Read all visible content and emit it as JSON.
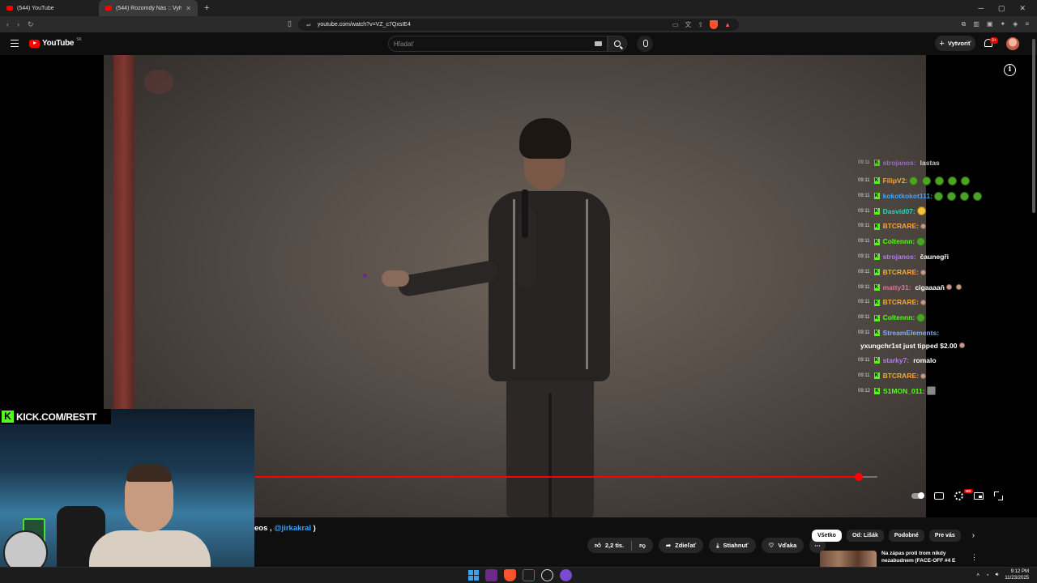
{
  "browser": {
    "tabs": [
      {
        "title": "(544) YouTube",
        "active": false
      },
      {
        "title": "(544) Rozomdý Nás :: Vyhraj",
        "active": true
      }
    ],
    "url": "youtube.com/watch?v=VZ_c7QxsIE4",
    "shield_badge": "1"
  },
  "youtube": {
    "logo": "YouTube",
    "region": "SK",
    "search_placeholder": "Hľadať",
    "create_label": "Vytvoriť",
    "notification_count": "9+"
  },
  "chat": {
    "cropped_top": {
      "time": "09:11",
      "user": "strojanos",
      "message": "lastas"
    },
    "messages": [
      {
        "time": "09:11",
        "user": "FilipV2",
        "color": "#f1a640",
        "message": "",
        "emotes": 5
      },
      {
        "time": "09:11",
        "user": "kokotkokot111",
        "color": "#3ea6ff",
        "message": "",
        "emotes": 4
      },
      {
        "time": "09:11",
        "user": "Dasvid07",
        "color": "#2fd3c1",
        "message": "",
        "emotes": 1
      },
      {
        "time": "09:11",
        "user": "BTCRARE",
        "color": "#f1a640",
        "message": "",
        "emotes": 1
      },
      {
        "time": "09:11",
        "user": "Coltennn",
        "color": "#53fc18",
        "message": "",
        "emotes": 1
      },
      {
        "time": "09:11",
        "user": "strojanos",
        "color": "#b57cf5",
        "message": "čaunegři",
        "emotes": 0
      },
      {
        "time": "09:11",
        "user": "BTCRARE",
        "color": "#f1a640",
        "message": "",
        "emotes": 1
      },
      {
        "time": "09:11",
        "user": "matty31",
        "color": "#e0709a",
        "message": "cigaaaaň",
        "emotes": 2
      },
      {
        "time": "09:11",
        "user": "BTCRARE",
        "color": "#f1a640",
        "message": "",
        "emotes": 1
      },
      {
        "time": "09:11",
        "user": "Coltennn",
        "color": "#53fc18",
        "message": "",
        "emotes": 1
      },
      {
        "time": "09:11",
        "user": "StreamElements",
        "color": "#8aa6ff",
        "message": "yxungchr1st just tipped $2.00",
        "emotes": 1
      },
      {
        "time": "09:11",
        "user": "starky7",
        "color": "#b57cf5",
        "message": "romalo",
        "emotes": 0
      },
      {
        "time": "09:11",
        "user": "BTCRARE",
        "color": "#f1a640",
        "message": "",
        "emotes": 1
      },
      {
        "time": "09:12",
        "user": "S1MON_011",
        "color": "#53fc18",
        "message": "",
        "emotes": 1
      }
    ]
  },
  "player": {
    "progress_fraction": 0.97,
    "buffered_fraction": 1.0,
    "hd_badge": "HD"
  },
  "webcam": {
    "banner": "KICK.COM/RESTT"
  },
  "below": {
    "desc_prefix": "eos ,",
    "desc_link": "@jirkakral",
    "desc_suffix": ")",
    "like_count": "2,2 tis.",
    "share_label": "Zdieľať",
    "download_label": "Stiahnuť",
    "thanks_label": "Vďaka",
    "chips": [
      "Všetko",
      "Od: Lišák",
      "Podobné",
      "Pre vás"
    ],
    "rec_title": "Na zápas proti trom nikdy nezabudnem (FACE-OFF #4 E"
  },
  "taskbar": {
    "time": "9:12 PM",
    "date": "11/23/2025"
  }
}
